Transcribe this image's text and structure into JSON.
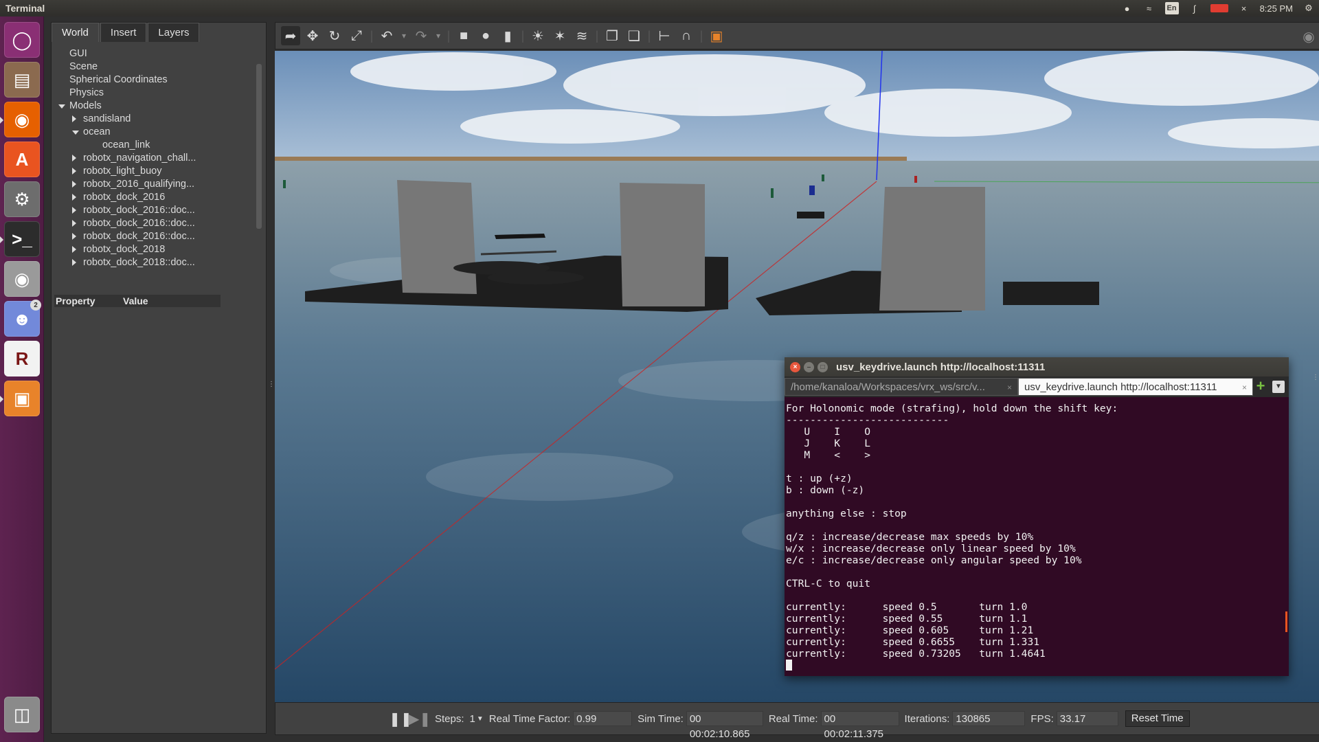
{
  "top_bar": {
    "app_name": "Terminal",
    "language": "En",
    "time": "8:25 PM"
  },
  "launcher": {
    "items": [
      {
        "name": "Ubuntu Dash",
        "icon": "ubuntu-logo-icon",
        "color": "#8a2f74"
      },
      {
        "name": "Files",
        "icon": "file-cabinet-icon",
        "color": "#8b6a4f"
      },
      {
        "name": "Firefox",
        "icon": "firefox-icon",
        "color": "#e66000"
      },
      {
        "name": "Ubuntu Software",
        "icon": "shopping-bag-icon",
        "color": "#e95420"
      },
      {
        "name": "System Settings",
        "icon": "gear-wrench-icon",
        "color": "#6d6d6d"
      },
      {
        "name": "Terminal",
        "icon": "terminal-icon",
        "color": "#2c2c2c"
      },
      {
        "name": "Screenshot",
        "icon": "camera-icon",
        "color": "#9a9a9a"
      },
      {
        "name": "Discord",
        "icon": "discord-icon",
        "color": "#7289da",
        "badge": "2"
      },
      {
        "name": "RStudio",
        "icon": "r-logo-icon",
        "color": "#f2f2f2"
      },
      {
        "name": "Gazebo",
        "icon": "gazebo-box-icon",
        "color": "#e8832a"
      },
      {
        "name": "Trash",
        "icon": "trash-icon",
        "color": "#8a8a8a"
      }
    ]
  },
  "gazebo": {
    "tabs": [
      "World",
      "Insert",
      "Layers"
    ],
    "active_tab": "World",
    "tree": [
      {
        "label": "GUI",
        "level": 0,
        "arrow": ""
      },
      {
        "label": "Scene",
        "level": 0,
        "arrow": ""
      },
      {
        "label": "Spherical Coordinates",
        "level": 0,
        "arrow": ""
      },
      {
        "label": "Physics",
        "level": 0,
        "arrow": ""
      },
      {
        "label": "Models",
        "level": 0,
        "arrow": "down"
      },
      {
        "label": "sandisland",
        "level": 1,
        "arrow": "right"
      },
      {
        "label": "ocean",
        "level": 1,
        "arrow": "down"
      },
      {
        "label": "ocean_link",
        "level": 2,
        "arrow": ""
      },
      {
        "label": "robotx_navigation_chall...",
        "level": 1,
        "arrow": "right"
      },
      {
        "label": "robotx_light_buoy",
        "level": 1,
        "arrow": "right"
      },
      {
        "label": "robotx_2016_qualifying...",
        "level": 1,
        "arrow": "right"
      },
      {
        "label": "robotx_dock_2016",
        "level": 1,
        "arrow": "right"
      },
      {
        "label": "robotx_dock_2016::doc...",
        "level": 1,
        "arrow": "right"
      },
      {
        "label": "robotx_dock_2016::doc...",
        "level": 1,
        "arrow": "right"
      },
      {
        "label": "robotx_dock_2016::doc...",
        "level": 1,
        "arrow": "right"
      },
      {
        "label": "robotx_dock_2018",
        "level": 1,
        "arrow": "right"
      },
      {
        "label": "robotx_dock_2018::doc...",
        "level": 1,
        "arrow": "right"
      }
    ],
    "property_header": {
      "property": "Property",
      "value": "Value"
    },
    "toolbar": {
      "icons": [
        "select-arrow-icon",
        "translate-icon",
        "rotate-icon",
        "scale-icon",
        "undo-icon",
        "undo-dropdown-icon",
        "redo-icon",
        "redo-dropdown-icon",
        "box-shape-icon",
        "sphere-shape-icon",
        "cylinder-shape-icon",
        "point-light-icon",
        "spot-light-icon",
        "directional-light-icon",
        "copy-icon",
        "paste-icon",
        "align-icon",
        "snap-icon",
        "view-angle-icon"
      ],
      "right_icons": [
        "screenshot-camera-icon",
        "log-record-icon"
      ]
    },
    "status": {
      "steps_label": "Steps:",
      "steps_value": "1",
      "rtf_label": "Real Time Factor:",
      "rtf_value": "0.99",
      "sim_label": "Sim Time:",
      "sim_value": "00 00:02:10.865",
      "real_label": "Real Time:",
      "real_value": "00 00:02:11.375",
      "iter_label": "Iterations:",
      "iter_value": "130865",
      "fps_label": "FPS:",
      "fps_value": "33.17",
      "reset_label": "Reset Time"
    }
  },
  "terminal": {
    "title": "usv_keydrive.launch http://localhost:11311",
    "tabs": [
      {
        "label": "/home/kanaloa/Workspaces/vrx_ws/src/v...",
        "active": false
      },
      {
        "label": "usv_keydrive.launch http://localhost:11311",
        "active": true
      }
    ],
    "lines": [
      "For Holonomic mode (strafing), hold down the shift key:",
      "---------------------------",
      "   U    I    O",
      "   J    K    L",
      "   M    <    >",
      "",
      "t : up (+z)",
      "b : down (-z)",
      "",
      "anything else : stop",
      "",
      "q/z : increase/decrease max speeds by 10%",
      "w/x : increase/decrease only linear speed by 10%",
      "e/c : increase/decrease only angular speed by 10%",
      "",
      "CTRL-C to quit",
      "",
      "currently:      speed 0.5       turn 1.0",
      "currently:      speed 0.55      turn 1.1",
      "currently:      speed 0.605     turn 1.21",
      "currently:      speed 0.6655    turn 1.331",
      "currently:      speed 0.73205   turn 1.4641"
    ]
  }
}
